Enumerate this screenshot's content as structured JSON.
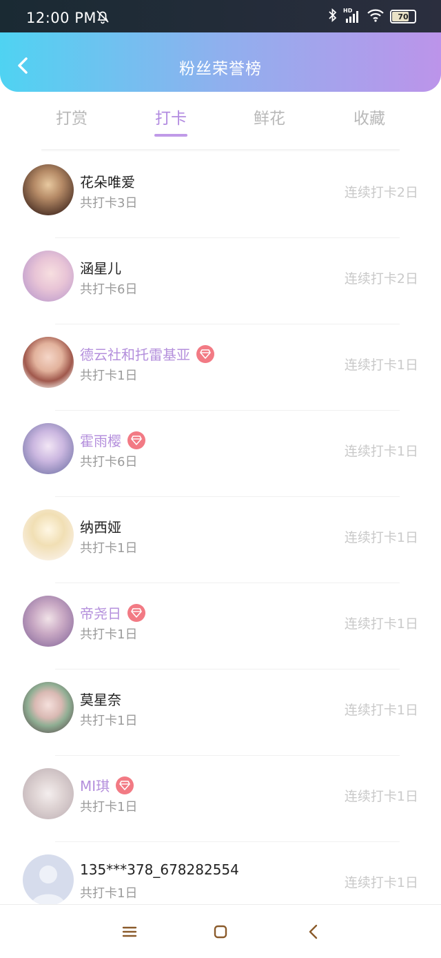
{
  "status_bar": {
    "time": "12:00 PM",
    "battery": "70",
    "network": "HD"
  },
  "header": {
    "title": "粉丝荣誉榜"
  },
  "tabs": [
    {
      "label": "打赏",
      "active": false
    },
    {
      "label": "打卡",
      "active": true
    },
    {
      "label": "鲜花",
      "active": false
    },
    {
      "label": "收藏",
      "active": false
    }
  ],
  "rows": [
    {
      "name": "花朵唯爱",
      "total": "共打卡3日",
      "streak": "连续打卡2日",
      "vip": false
    },
    {
      "name": "涵星儿",
      "total": "共打卡6日",
      "streak": "连续打卡2日",
      "vip": false
    },
    {
      "name": "德云社和托雷基亚",
      "total": "共打卡1日",
      "streak": "连续打卡1日",
      "vip": true
    },
    {
      "name": "霍雨樱",
      "total": "共打卡6日",
      "streak": "连续打卡1日",
      "vip": true
    },
    {
      "name": "纳西娅",
      "total": "共打卡1日",
      "streak": "连续打卡1日",
      "vip": false
    },
    {
      "name": "帝尧日",
      "total": "共打卡1日",
      "streak": "连续打卡1日",
      "vip": true
    },
    {
      "name": "莫星奈",
      "total": "共打卡1日",
      "streak": "连续打卡1日",
      "vip": false
    },
    {
      "name": "MI琪",
      "total": "共打卡1日",
      "streak": "连续打卡1日",
      "vip": true
    },
    {
      "name": "135***378_678282554",
      "total": "共打卡1日",
      "streak": "连续打卡1日",
      "vip": false
    }
  ],
  "colors": {
    "accent": "#b28be0",
    "vip_name": "#b48fdc",
    "gem": "#f27a84"
  }
}
